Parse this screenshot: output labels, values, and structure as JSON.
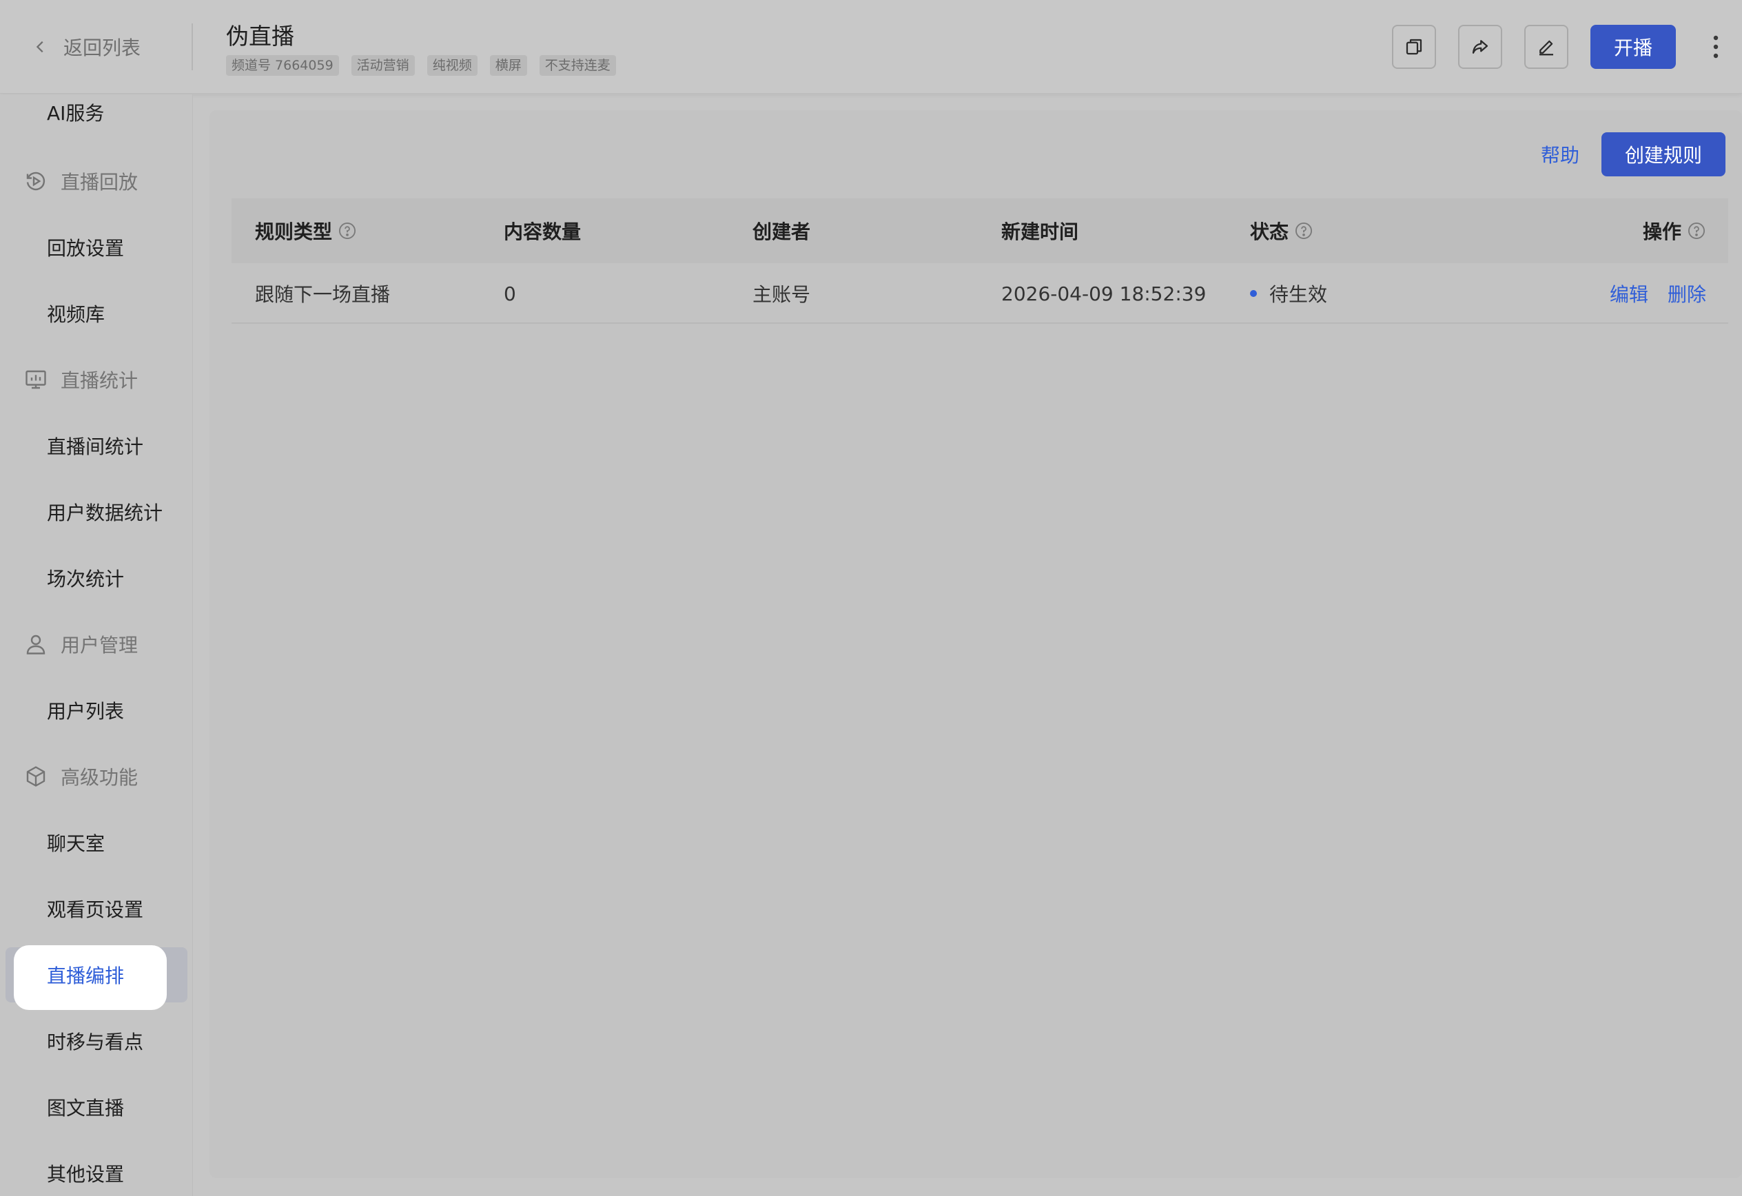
{
  "header": {
    "back_label": "返回列表",
    "title": "伪直播",
    "tags": [
      "频道号 7664059",
      "活动营销",
      "纯视频",
      "横屏",
      "不支持连麦"
    ],
    "start_label": "开播",
    "icons": [
      "copy-icon",
      "share-icon",
      "edit-icon",
      "more-vertical-icon"
    ]
  },
  "sidebar": {
    "items": [
      {
        "label": "AI服务",
        "type": "item"
      },
      {
        "label": "直播回放",
        "type": "group",
        "icon": "replay-icon"
      },
      {
        "label": "回放设置",
        "type": "item"
      },
      {
        "label": "视频库",
        "type": "item"
      },
      {
        "label": "直播统计",
        "type": "group",
        "icon": "stats-icon"
      },
      {
        "label": "直播间统计",
        "type": "item"
      },
      {
        "label": "用户数据统计",
        "type": "item"
      },
      {
        "label": "场次统计",
        "type": "item"
      },
      {
        "label": "用户管理",
        "type": "group",
        "icon": "user-icon"
      },
      {
        "label": "用户列表",
        "type": "item"
      },
      {
        "label": "高级功能",
        "type": "group",
        "icon": "cube-icon"
      },
      {
        "label": "聊天室",
        "type": "item"
      },
      {
        "label": "观看页设置",
        "type": "item"
      },
      {
        "label": "直播编排",
        "type": "item",
        "active": true
      },
      {
        "label": "时移与看点",
        "type": "item"
      },
      {
        "label": "图文直播",
        "type": "item"
      },
      {
        "label": "其他设置",
        "type": "item"
      }
    ]
  },
  "main": {
    "help_label": "帮助",
    "create_label": "创建规则",
    "table": {
      "columns": [
        "规则类型",
        "内容数量",
        "创建者",
        "新建时间",
        "状态",
        "操作"
      ],
      "rows": [
        {
          "rule_type": "跟随下一场直播",
          "count": "0",
          "creator": "主账号",
          "created_at": "2026-04-09 18:52:39",
          "status": "待生效",
          "actions": [
            "编辑",
            "删除"
          ]
        }
      ]
    }
  },
  "colors": {
    "accent": "#3756c4",
    "link": "#2f5ed8",
    "background": "#c6c6c6"
  }
}
